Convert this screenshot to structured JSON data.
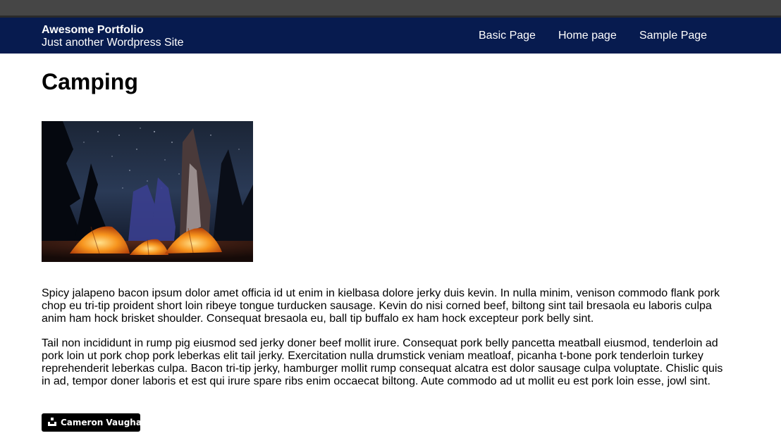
{
  "site": {
    "title": "Awesome Portfolio",
    "tagline": "Just another Wordpress Site",
    "header_color": "#071b4f"
  },
  "nav": {
    "items": [
      {
        "label": "Basic Page"
      },
      {
        "label": "Home page"
      },
      {
        "label": "Sample Page"
      }
    ]
  },
  "page": {
    "title": "Camping",
    "featured_image": {
      "description": "night-camping-tents-icon"
    },
    "paragraphs": [
      "Spicy jalapeno bacon ipsum dolor amet officia id ut enim in kielbasa dolore jerky duis kevin. In nulla minim, venison commodo flank pork chop eu tri-tip proident short loin ribeye tongue turducken sausage. Kevin do nisi corned beef, biltong sint tail bresaola eu laboris culpa anim ham hock brisket shoulder. Consequat bresaola eu, ball tip buffalo ex ham hock excepteur pork belly sint.",
      "Tail non incididunt in rump pig eiusmod sed jerky doner beef mollit irure. Consequat pork belly pancetta meatball eiusmod, tenderloin ad pork loin ut pork chop pork leberkas elit tail jerky. Exercitation nulla drumstick veniam meatloaf, picanha t-bone pork tenderloin turkey reprehenderit leberkas culpa. Bacon tri-tip jerky, hamburger mollit rump consequat alcatra est dolor sausage culpa voluptate. Chislic quis in ad, tempor doner laboris et est qui irure spare ribs enim occaecat biltong. Aute commodo ad ut mollit eu est pork loin esse, jowl sint."
    ],
    "author": {
      "name": "Cameron Vaughan",
      "icon": "user-icon"
    }
  }
}
